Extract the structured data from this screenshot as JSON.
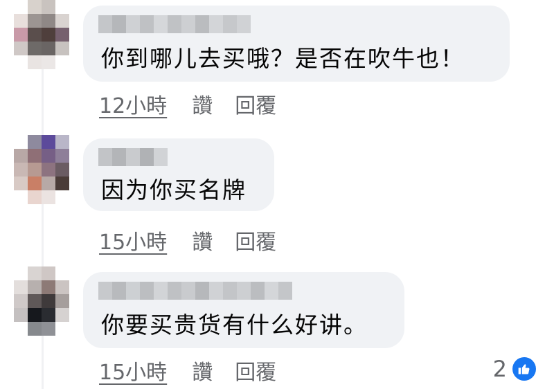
{
  "comments": [
    {
      "text": "你到哪儿去买哦？是否在吹牛也！",
      "time": "12小時",
      "like_label": "讚",
      "reply_label": "回覆"
    },
    {
      "text": "因为你买名牌",
      "time": "15小時",
      "like_label": "讚",
      "reply_label": "回覆"
    },
    {
      "text": "你要买贵货有什么好讲。",
      "time": "15小時",
      "like_label": "讚",
      "reply_label": "回覆",
      "reaction_count": "2",
      "reaction_icon": "like-icon"
    }
  ],
  "colors": {
    "bubble": "#f0f2f5",
    "meta_text": "#65676b",
    "like_blue": "#1877f2"
  }
}
